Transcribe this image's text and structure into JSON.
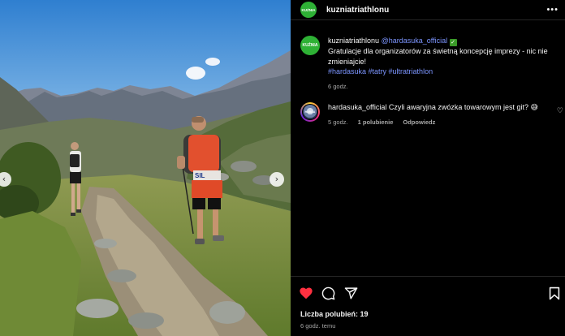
{
  "post": {
    "author": "kuzniatriathlonu",
    "avatar_text": "KUŹNIA",
    "more_label": "•••"
  },
  "photo": {
    "prev_label": "‹",
    "next_label": "›",
    "jersey_text": "SIL"
  },
  "comments": [
    {
      "author": "kuzniatriathlonu",
      "mention": "@hardasuka_official",
      "verified_mark": "✓",
      "text": "Gratulacje dla organizatorów za świetną koncepcję imprezy - nic nie zmieniajcie!",
      "hashtags": "#hardasuka #tatry #ultratriathlon",
      "time": "6 godz."
    },
    {
      "author": "hardasuka_official",
      "text": "Czyli awaryjna zwózka towarowym jest git? 😅",
      "time": "5 godz.",
      "likes": "1 polubienie",
      "reply": "Odpowiedz",
      "avatar_text": "HARDA"
    }
  ],
  "footer": {
    "likes": "Liczba polubień: 19",
    "time_ago": "6 godz. temu"
  },
  "colors": {
    "background": "#000000",
    "link": "#7c95ff",
    "heart": "#ff3040",
    "brand_green": "#2eb135"
  },
  "icons": [
    "heart-icon",
    "comment-icon",
    "share-icon",
    "bookmark-icon",
    "more-icon",
    "verified-icon"
  ]
}
